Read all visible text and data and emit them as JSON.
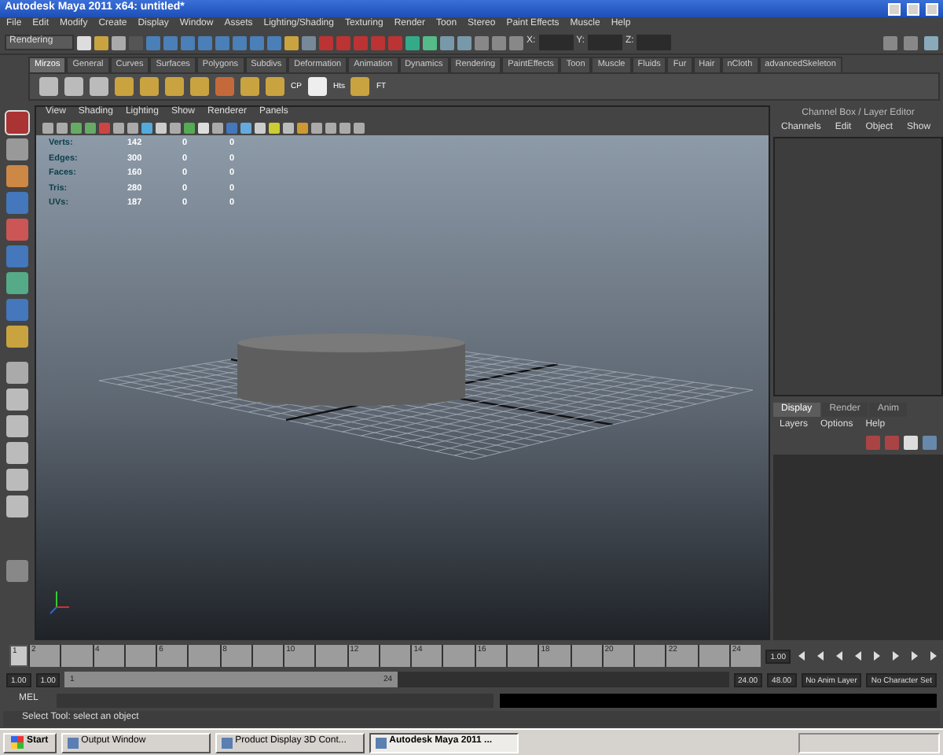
{
  "window": {
    "title": "Autodesk Maya 2011 x64: untitled*"
  },
  "menu": [
    "File",
    "Edit",
    "Modify",
    "Create",
    "Display",
    "Window",
    "Assets",
    "Lighting/Shading",
    "Texturing",
    "Render",
    "Toon",
    "Stereo",
    "Paint Effects",
    "Muscle",
    "Help"
  ],
  "status_line": {
    "mode": "Rendering",
    "coord_labels": [
      "X:",
      "Y:",
      "Z:"
    ]
  },
  "shelf": {
    "tabs": [
      {
        "label": "Mirzos",
        "selected": true
      },
      {
        "label": "General",
        "selected": false
      },
      {
        "label": "Curves",
        "selected": false
      },
      {
        "label": "Surfaces",
        "selected": false
      },
      {
        "label": "Polygons",
        "selected": false
      },
      {
        "label": "Subdivs",
        "selected": false
      },
      {
        "label": "Deformation",
        "selected": false
      },
      {
        "label": "Animation",
        "selected": false
      },
      {
        "label": "Dynamics",
        "selected": false
      },
      {
        "label": "Rendering",
        "selected": false
      },
      {
        "label": "PaintEffects",
        "selected": false
      },
      {
        "label": "Toon",
        "selected": false
      },
      {
        "label": "Muscle",
        "selected": false
      },
      {
        "label": "Fluids",
        "selected": false
      },
      {
        "label": "Fur",
        "selected": false
      },
      {
        "label": "Hair",
        "selected": false
      },
      {
        "label": "nCloth",
        "selected": false
      },
      {
        "label": "advancedSkeleton",
        "selected": false
      }
    ],
    "tool_labels": [
      "CP",
      "Hts",
      "FT"
    ]
  },
  "viewport": {
    "menu": [
      "View",
      "Shading",
      "Lighting",
      "Show",
      "Renderer",
      "Panels"
    ],
    "hud": [
      {
        "label": "Verts:",
        "values": [
          "142",
          "0",
          "0"
        ]
      },
      {
        "label": "Edges:",
        "values": [
          "300",
          "0",
          "0"
        ]
      },
      {
        "label": "Faces:",
        "values": [
          "160",
          "0",
          "0"
        ]
      },
      {
        "label": "Tris:",
        "values": [
          "280",
          "0",
          "0"
        ]
      },
      {
        "label": "UVs:",
        "values": [
          "187",
          "0",
          "0"
        ]
      }
    ]
  },
  "channel_box": {
    "title": "Channel Box / Layer Editor",
    "menu": [
      "Channels",
      "Edit",
      "Object",
      "Show"
    ]
  },
  "layer_editor": {
    "tabs": [
      {
        "label": "Display",
        "selected": true
      },
      {
        "label": "Render",
        "selected": false
      },
      {
        "label": "Anim",
        "selected": false
      }
    ],
    "menu": [
      "Layers",
      "Options",
      "Help"
    ]
  },
  "time_slider": {
    "level": 0,
    "start_label": "1",
    "tick_labels": [
      "2",
      "4",
      "6",
      "8",
      "10",
      "12",
      "14",
      "16",
      "18",
      "20",
      "22",
      "24"
    ],
    "current_frame": "1.00"
  },
  "range_slider": {
    "start": "1.00",
    "playback_start": "1.00",
    "range_start": "1",
    "range_end": "24",
    "level": 0.5,
    "playback_end": "24.00",
    "end": "48.00",
    "anim_layer": "No Anim Layer",
    "character_set": "No Character Set"
  },
  "command_line": {
    "label": "MEL"
  },
  "help_line": "Select Tool: select an object",
  "taskbar": {
    "start": "Start",
    "items": [
      {
        "label": "Output Window",
        "selected": false
      },
      {
        "label": "Product Display 3D Cont...",
        "selected": false
      },
      {
        "label": "Autodesk Maya 2011 ...",
        "selected": true
      }
    ]
  }
}
